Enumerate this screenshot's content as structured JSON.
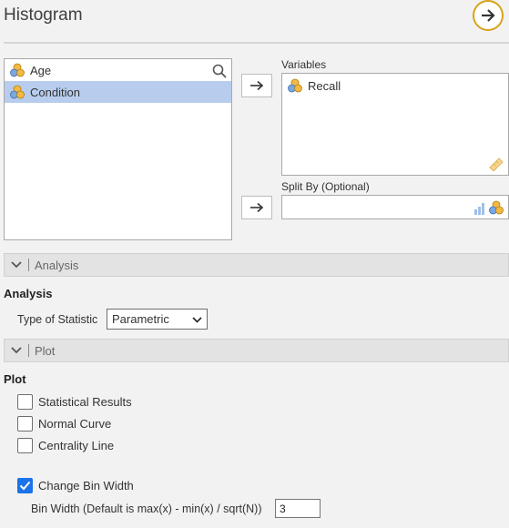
{
  "header": {
    "title": "Histogram",
    "run_icon": "arrow-right-circle-icon",
    "accent": "#d7a31a"
  },
  "source_list": {
    "items": [
      {
        "label": "Age",
        "selected": false,
        "icon": "nominal-variable-icon"
      },
      {
        "label": "Condition",
        "selected": true,
        "icon": "nominal-variable-icon"
      }
    ],
    "search_icon": "search-icon"
  },
  "targets": {
    "variables": {
      "label": "Variables",
      "items": [
        {
          "label": "Recall",
          "icon": "nominal-variable-icon"
        }
      ],
      "drop_icon": "ruler-icon"
    },
    "split_by": {
      "label": "Split By (Optional)",
      "type_icon": "bar-chart-nominal-icon"
    }
  },
  "analysis_section": {
    "bar_label": "Analysis",
    "heading": "Analysis",
    "type_label": "Type of Statistic",
    "type_value": "Parametric"
  },
  "plot_section": {
    "bar_label": "Plot",
    "heading": "Plot",
    "checkboxes": [
      {
        "label": "Statistical Results",
        "checked": false
      },
      {
        "label": "Normal Curve",
        "checked": false
      },
      {
        "label": "Centrality Line",
        "checked": false
      },
      {
        "label": "Change Bin Width",
        "checked": true
      }
    ],
    "bin_width_label": "Bin Width (Default is max(x) - min(x) / sqrt(N))",
    "bin_width_value": "3"
  }
}
